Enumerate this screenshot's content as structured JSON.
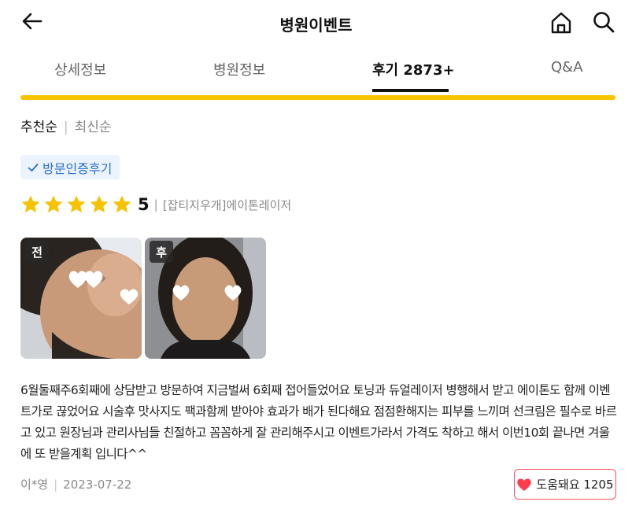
{
  "header": {
    "title": "병원이벤트",
    "back_icon": "arrow-left-icon",
    "home_icon": "home-icon",
    "search_icon": "search-icon"
  },
  "tabs": [
    {
      "label": "상세정보",
      "active": false
    },
    {
      "label": "병원정보",
      "active": false
    },
    {
      "label": "후기 2873+",
      "active": true
    },
    {
      "label": "Q&A",
      "active": false
    }
  ],
  "sort": {
    "recommended": "추천순",
    "latest": "최신순"
  },
  "badge": {
    "label": "방문인증후기",
    "icon": "check-icon"
  },
  "rating": {
    "stars": 5,
    "score": "5",
    "product": "[잡티지우개]에이톤레이저"
  },
  "photos": {
    "before_label": "전",
    "after_label": "후"
  },
  "review": {
    "text": "6월둘째주6회째에 상담받고 방문하여 지금벌써 6회째 접어들었어요 토닝과 듀얼레이저 병행해서 받고 에이톤도 함께 이벤트가로 끊었어요 시술후 맛사지도 팩과함께 받아야 효과가 배가 된다해요 점점환해지는 피부를 느끼며 선크림은 필수로 바르고 있고 원장님과 관리사님들 친절하고 꼼꼼하게 잘 관리해주시고 이벤트가라서 가격도 착하고 해서 이번10회 끝나면 겨울에 또 받을계획 입니다^^",
    "author": "이*영",
    "date": "2023-07-22"
  },
  "helpful": {
    "label": "도움돼요 1205",
    "icon": "heart-icon"
  },
  "colors": {
    "accent_yellow": "#f6c500",
    "badge_blue": "#2a6fd1",
    "badge_bg": "#eaf3ff",
    "heart_red": "#ff3b4e",
    "star_yellow": "#f7c200"
  }
}
